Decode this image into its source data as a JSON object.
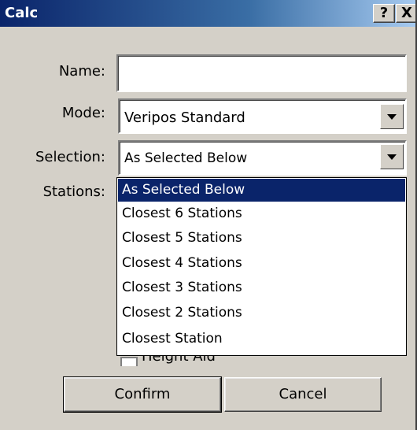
{
  "window": {
    "title": "Calc",
    "help_label": "?",
    "close_label": "X"
  },
  "form": {
    "name_label": "Name:",
    "name_value": "",
    "mode_label": "Mode:",
    "mode_value": "Veripos Standard",
    "selection_label": "Selection:",
    "selection_value": "As Selected Below",
    "stations_label": "Stations:",
    "height_aid_label": "Height Aid"
  },
  "dropdown": {
    "options": [
      "As Selected Below",
      "Closest 6 Stations",
      "Closest 5 Stations",
      "Closest 4 Stations",
      "Closest 3 Stations",
      "Closest 2 Stations",
      "Closest Station"
    ],
    "selected_index": 0
  },
  "buttons": {
    "confirm": "Confirm",
    "cancel": "Cancel"
  },
  "colors": {
    "titlebar": "#0a246a",
    "highlight": "#0a246a",
    "face": "#d4d0c8"
  }
}
